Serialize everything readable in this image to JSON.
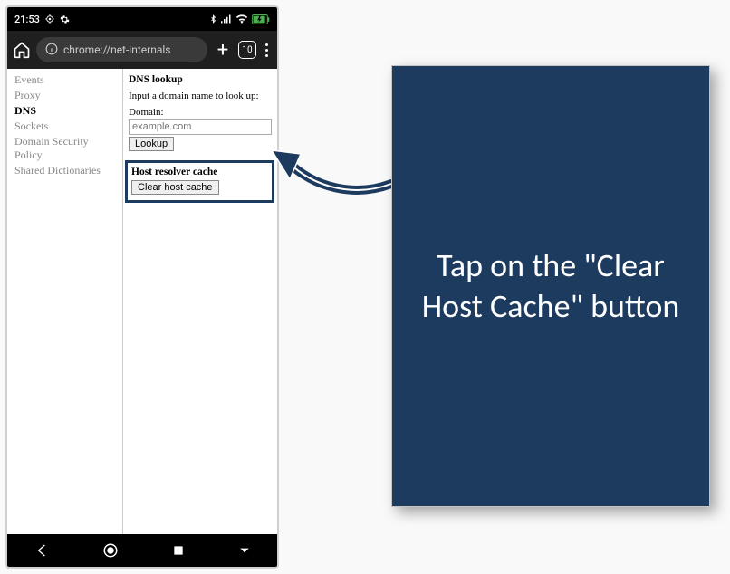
{
  "status": {
    "time": "21:53",
    "icons_left": [
      "location-icon",
      "settings-gear-icon"
    ],
    "icons_right": [
      "bluetooth-icon",
      "signal-strength-icon",
      "wifi-icon",
      "battery-icon"
    ]
  },
  "browser": {
    "url": "chrome://net-internals",
    "tab_count": "10"
  },
  "sidebar": {
    "items": [
      {
        "label": "Events",
        "active": false
      },
      {
        "label": "Proxy",
        "active": false
      },
      {
        "label": "DNS",
        "active": true
      },
      {
        "label": "Sockets",
        "active": false
      },
      {
        "label": "Domain Security Policy",
        "active": false
      },
      {
        "label": "Shared Dictionaries",
        "active": false
      }
    ]
  },
  "main": {
    "dns_lookup_title": "DNS lookup",
    "dns_lookup_instruction": "Input a domain name to look up:",
    "domain_label": "Domain:",
    "domain_placeholder": "example.com",
    "lookup_button": "Lookup",
    "host_cache_title": "Host resolver cache",
    "clear_cache_button": "Clear host cache"
  },
  "callout": {
    "text": "Tap on the \"Clear Host Cache\" button"
  },
  "colors": {
    "accent": "#1d3a5f"
  }
}
